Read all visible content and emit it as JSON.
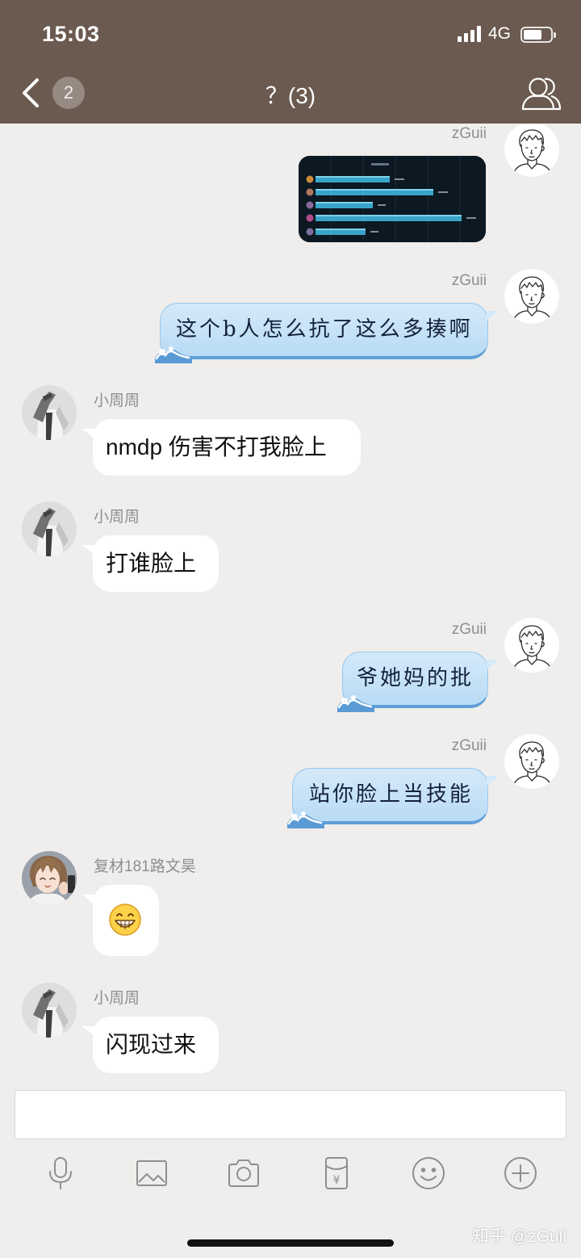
{
  "status_bar": {
    "time": "15:03",
    "network": "4G",
    "signal_bars": 4,
    "battery_percent": 70,
    "signal_icon": "signal-bars-icon",
    "battery_icon": "battery-icon"
  },
  "header": {
    "back_icon": "chevron-left-icon",
    "unread_badge": "2",
    "title": "？(3)",
    "members_icon": "group-members-icon"
  },
  "messages": [
    {
      "sender": "zGuii"
    },
    {
      "sender": "zGuii",
      "text": "这个b人怎么抗了这么多揍啊"
    },
    {
      "sender": "小周周",
      "text": "nmdp 伤害不打我脸上"
    },
    {
      "sender": "小周周",
      "text": "打谁脸上"
    },
    {
      "sender": "zGuii",
      "text": "爷她妈的批"
    },
    {
      "sender": "zGuii",
      "text": "站你脸上当技能"
    },
    {
      "sender": "复材181路文昊",
      "emoji_icon": "grinning-face-icon"
    },
    {
      "sender": "小周周",
      "text": "闪现过来"
    }
  ],
  "toolbar": [
    {
      "icon": "microphone-icon"
    },
    {
      "icon": "image-icon"
    },
    {
      "icon": "camera-icon"
    },
    {
      "icon": "red-packet-icon",
      "glyph": "¥"
    },
    {
      "icon": "emoji-icon"
    },
    {
      "icon": "plus-icon"
    }
  ],
  "watermark": "知乎 @zGuii",
  "colors": {
    "header_bg": "#6b5a4f",
    "chat_bg": "#efeeec",
    "sender_name": "#8e8e93",
    "icon_gray": "#8e8e93",
    "bubble_white": "#ffffff",
    "bubble_blue_top": "#d4e9f9",
    "bubble_blue_bottom": "#b9dbf5",
    "bubble_blue_edge": "#5f9fd8"
  }
}
